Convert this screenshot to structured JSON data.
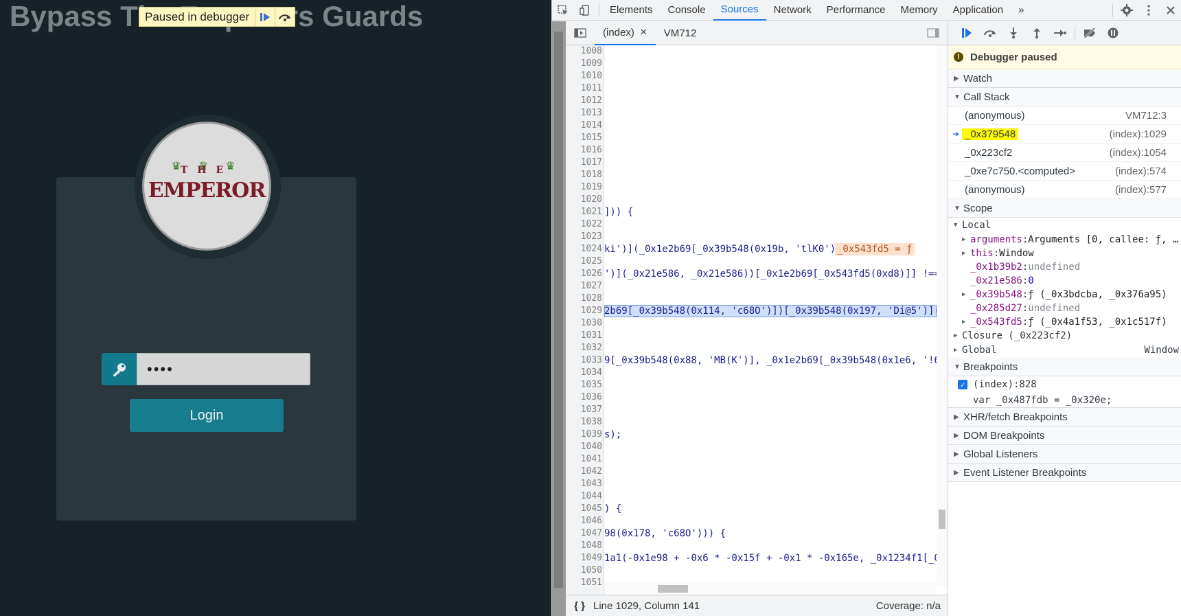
{
  "page": {
    "title": "Bypass The Emperors Guards",
    "paused_banner": "Paused in debugger",
    "logo": {
      "crowns": "♛ ♛ ♛",
      "small_text": "THE",
      "brand_text": "EMPEROR"
    },
    "password_value": "••••",
    "login_label": "Login"
  },
  "devtools": {
    "tabs": [
      {
        "label": "Elements",
        "active": false
      },
      {
        "label": "Console",
        "active": false
      },
      {
        "label": "Sources",
        "active": true
      },
      {
        "label": "Network",
        "active": false
      },
      {
        "label": "Performance",
        "active": false
      },
      {
        "label": "Memory",
        "active": false
      },
      {
        "label": "Application",
        "active": false
      }
    ],
    "more_tabs": "»",
    "source_tabs": [
      {
        "label": "(index)",
        "active": true
      },
      {
        "label": "VM712",
        "active": false
      }
    ],
    "code_lines": [
      {
        "n": "1008",
        "t": ""
      },
      {
        "n": "1009",
        "t": ""
      },
      {
        "n": "1010",
        "t": ""
      },
      {
        "n": "1011",
        "t": ""
      },
      {
        "n": "1012",
        "t": ""
      },
      {
        "n": "1013",
        "t": ""
      },
      {
        "n": "1014",
        "t": ""
      },
      {
        "n": "1015",
        "t": ""
      },
      {
        "n": "1016",
        "t": ""
      },
      {
        "n": "1017",
        "t": ""
      },
      {
        "n": "1018",
        "t": ""
      },
      {
        "n": "1019",
        "t": ""
      },
      {
        "n": "1020",
        "t": ""
      },
      {
        "n": "1021",
        "t": "])) {"
      },
      {
        "n": "1022",
        "t": ""
      },
      {
        "n": "1023",
        "t": ""
      },
      {
        "n": "1024",
        "t": "ki')](_0x1e2b69[_0x39b548(0x19b, 'tlK0')]);",
        "inline": "_0x543fd5 = ƒ"
      },
      {
        "n": "1025",
        "t": ""
      },
      {
        "n": "1026",
        "t": "')](_0x21e586, _0x21e586))[_0x1e2b69[_0x543fd5(0xd8)]] !=="
      },
      {
        "n": "1027",
        "t": ""
      },
      {
        "n": "1028",
        "t": ""
      },
      {
        "n": "1029",
        "t": "2b69[_0x39b548(0x114, 'c68O')])[_0x39b548(0x197, 'Di@5')](",
        "exec": true
      },
      {
        "n": "1030",
        "t": ""
      },
      {
        "n": "1031",
        "t": ""
      },
      {
        "n": "1032",
        "t": ""
      },
      {
        "n": "1033",
        "t": "9[_0x39b548(0x88, 'MB(K')], _0x1e2b69[_0x39b548(0x1e6, '!6C"
      },
      {
        "n": "1034",
        "t": ""
      },
      {
        "n": "1035",
        "t": ""
      },
      {
        "n": "1036",
        "t": ""
      },
      {
        "n": "1037",
        "t": ""
      },
      {
        "n": "1038",
        "t": ""
      },
      {
        "n": "1039",
        "t": "s);"
      },
      {
        "n": "1040",
        "t": ""
      },
      {
        "n": "1041",
        "t": ""
      },
      {
        "n": "1042",
        "t": ""
      },
      {
        "n": "1043",
        "t": ""
      },
      {
        "n": "1044",
        "t": ""
      },
      {
        "n": "1045",
        "t": ") {"
      },
      {
        "n": "1046",
        "t": ""
      },
      {
        "n": "1047",
        "t": "98(0x178, 'c68O'))) {"
      },
      {
        "n": "1048",
        "t": ""
      },
      {
        "n": "1049",
        "t": "1a1(-0x1e98 + -0x6 * -0x15f + -0x1 * -0x165e, _0x1234f1[_0x"
      },
      {
        "n": "1050",
        "t": ""
      },
      {
        "n": "1051",
        "t": ""
      }
    ],
    "status": {
      "braces": "{ }",
      "position": "Line 1029, Column 141",
      "coverage": "Coverage: n/a"
    },
    "sidebar": {
      "paused": "Debugger paused",
      "watch": "Watch",
      "call_stack": "Call Stack",
      "frames": [
        {
          "fn": "(anonymous)",
          "loc": "VM712:3",
          "current": false
        },
        {
          "fn": "_0x379548",
          "loc": "(index):1029",
          "current": true
        },
        {
          "fn": "_0x223cf2",
          "loc": "(index):1054",
          "current": false
        },
        {
          "fn": "_0xe7c750.<computed>",
          "loc": "(index):574",
          "current": false
        },
        {
          "fn": "(anonymous)",
          "loc": "(index):577",
          "current": false
        }
      ],
      "scope": "Scope",
      "local": "Local",
      "scope_vars": [
        {
          "k": "arguments",
          "v": "Arguments [0, callee: ƒ, …",
          "expand": true,
          "cls": "sv-fn"
        },
        {
          "k": "this",
          "v": "Window",
          "expand": true,
          "cls": "sv-fn"
        },
        {
          "k": "_0x1b39b2",
          "v": "undefined",
          "expand": false,
          "cls": "sv-und"
        },
        {
          "k": "_0x21e586",
          "v": "0",
          "expand": false,
          "cls": "sv-num"
        },
        {
          "k": "_0x39b548",
          "v": "ƒ (_0x3bdcba, _0x376a95)",
          "expand": true,
          "cls": "sv-fn"
        },
        {
          "k": "_0x285d27",
          "v": "undefined",
          "expand": false,
          "cls": "sv-und"
        },
        {
          "k": "_0x543fd5",
          "v": "ƒ (_0x4a1f53, _0x1c517f)",
          "expand": true,
          "cls": "sv-fn"
        }
      ],
      "closure": "Closure (_0x223cf2)",
      "global": "Global",
      "global_val": "Window",
      "breakpoints": "Breakpoints",
      "bp_location": "(index):828",
      "bp_code": "var _0x487fdb = _0x320e;",
      "xhr": "XHR/fetch Breakpoints",
      "dom": "DOM Breakpoints",
      "global_listeners": "Global Listeners",
      "event_listeners": "Event Listener Breakpoints"
    }
  }
}
